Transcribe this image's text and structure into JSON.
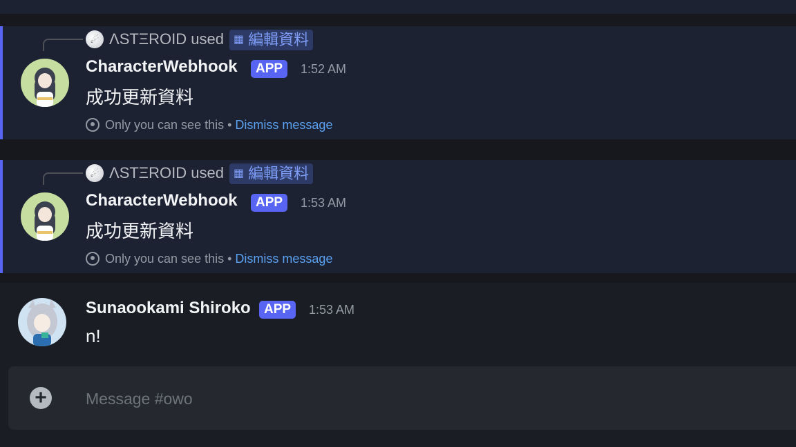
{
  "messages": [
    {
      "referenced_user": "ΛSTΞROID used",
      "command": "編輯資料",
      "author": "CharacterWebhook",
      "badge": "APP",
      "time": "1:52 AM",
      "content": "成功更新資料",
      "ephemeral_text": "Only you can see this •",
      "dismiss_label": "Dismiss message"
    },
    {
      "referenced_user": "ΛSTΞROID used",
      "command": "編輯資料",
      "author": "CharacterWebhook",
      "badge": "APP",
      "time": "1:53 AM",
      "content": "成功更新資料",
      "ephemeral_text": "Only you can see this •",
      "dismiss_label": "Dismiss message"
    },
    {
      "author": "Sunaookami Shiroko",
      "badge": "APP",
      "time": "1:53 AM",
      "content": "n!"
    }
  ],
  "composer": {
    "placeholder": "Message #owo"
  },
  "icons": {
    "command": "app-command-icon",
    "ephemeral": "eye-icon",
    "add": "plus-circle-icon"
  },
  "colors": {
    "accent": "#5865f2",
    "link": "#5aa2f2",
    "highlight_bg": "#1d2233"
  }
}
